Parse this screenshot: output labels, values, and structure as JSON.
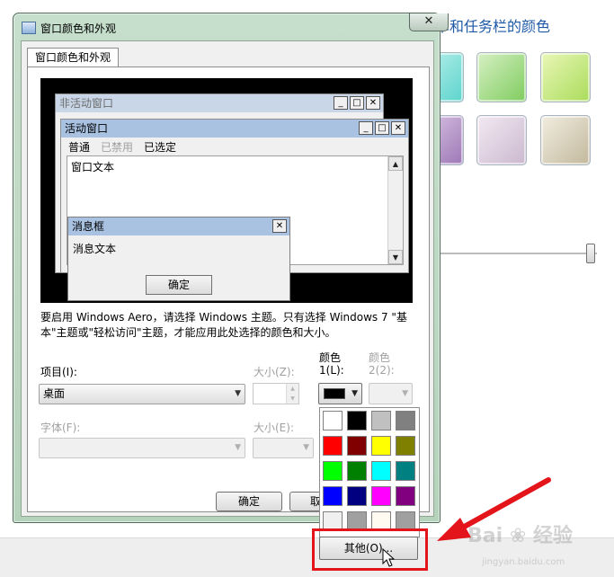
{
  "background": {
    "panel_title": "单和任务栏的颜色"
  },
  "dialog": {
    "title": "窗口颜色和外观",
    "close_glyph": "✕",
    "tab_label": "窗口颜色和外观",
    "preview": {
      "inactive_window_title": "非活动窗口",
      "active_window_title": "活动窗口",
      "menu_items": [
        "普通",
        "已禁用",
        "已选定"
      ],
      "window_text": "窗口文本",
      "message_box_title": "消息框",
      "message_text": "消息文本",
      "ok_label": "确定",
      "minimize_glyph": "_",
      "maximize_glyph": "□",
      "close_glyph": "✕"
    },
    "description": "要启用 Windows Aero，请选择 Windows 主题。只有选择 Windows 7 \"基本\"主题或\"轻松访问\"主题，才能应用此处选择的颜色和大小。",
    "item_label": "项目(I):",
    "item_value": "桌面",
    "size_z_label": "大小(Z):",
    "color1_label_line1": "颜色",
    "color1_label_line2": "1(L):",
    "color2_label_line1": "颜色",
    "color2_label_line2": "2(2):",
    "font_label": "字体(F):",
    "size_e_label": "大小(E):",
    "ok_button": "确定",
    "cancel_button_partial": "取",
    "color1_value": "#000000"
  },
  "palette": {
    "colors": [
      "#ffffff",
      "#000000",
      "#c0c0c0",
      "#808080",
      "#ff0000",
      "#800000",
      "#ffff00",
      "#808000",
      "#00ff00",
      "#008000",
      "#00ffff",
      "#008080",
      "#0000ff",
      "#000080",
      "#ff00ff",
      "#800080",
      "#f0f0f0",
      "#a0a0a0",
      "#fffbf0",
      "#a0a0a0"
    ],
    "other_button": "其他(O)..."
  },
  "watermark": {
    "brand": "Bai",
    "brand_suffix": "经验",
    "url": "jingyan.baidu.com"
  },
  "colors": {
    "active_title": "#a9c2e2",
    "inactive_title": "#c8d6e8",
    "highlight": "#e4141b"
  }
}
